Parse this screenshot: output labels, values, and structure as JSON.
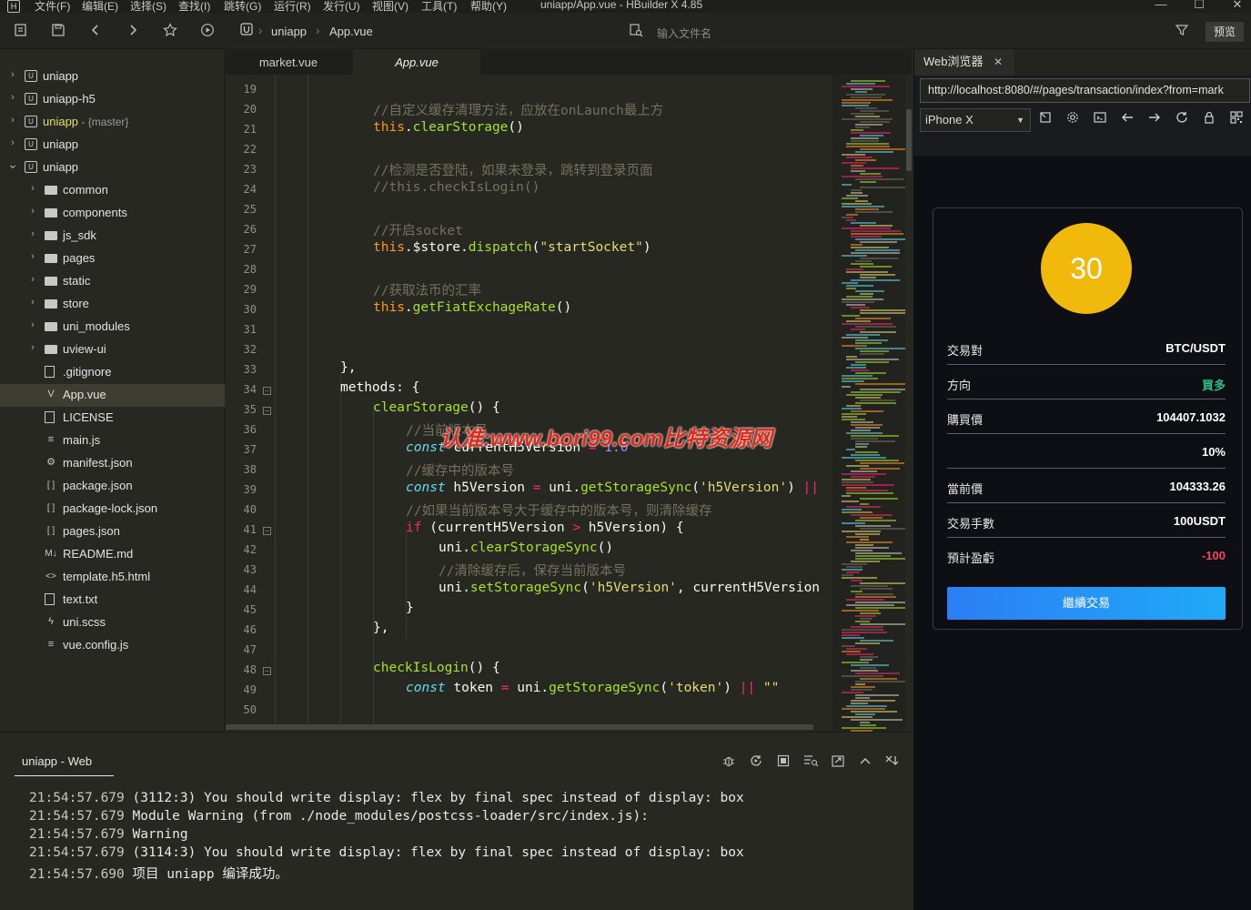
{
  "app": {
    "title": "uniapp/App.vue - HBuilder X 4.85",
    "logo": "H"
  },
  "menu": [
    "文件(F)",
    "编辑(E)",
    "选择(S)",
    "查找(I)",
    "跳转(G)",
    "运行(R)",
    "发行(U)",
    "视图(V)",
    "工具(T)",
    "帮助(Y)"
  ],
  "window_controls": [
    "—",
    "☐",
    "✕"
  ],
  "toolbar": {
    "breadcrumb": [
      "uniapp",
      "App.vue"
    ],
    "search_placeholder": "输入文件名",
    "preview_label": "预览",
    "icons": [
      "new-file-icon",
      "save-icon",
      "back-icon",
      "forward-icon",
      "star-icon",
      "run-icon",
      "filter-icon"
    ]
  },
  "sidebar": {
    "items": [
      {
        "label": "uniapp",
        "extra": "",
        "type": "project",
        "level": 0,
        "expanded": false
      },
      {
        "label": "uniapp-h5",
        "extra": "",
        "type": "project",
        "level": 0,
        "expanded": false
      },
      {
        "label": "uniapp",
        "extra": " - {master}",
        "type": "project",
        "level": 0,
        "expanded": false,
        "highlight": true
      },
      {
        "label": "uniapp",
        "extra": "",
        "type": "project",
        "level": 0,
        "expanded": false
      },
      {
        "label": "uniapp",
        "extra": "",
        "type": "project",
        "level": 0,
        "expanded": true
      },
      {
        "label": "common",
        "extra": "",
        "type": "folder",
        "level": 1
      },
      {
        "label": "components",
        "extra": "",
        "type": "folder",
        "level": 1
      },
      {
        "label": "js_sdk",
        "extra": "",
        "type": "folder",
        "level": 1
      },
      {
        "label": "pages",
        "extra": "",
        "type": "folder",
        "level": 1
      },
      {
        "label": "static",
        "extra": "",
        "type": "folder",
        "level": 1
      },
      {
        "label": "store",
        "extra": "",
        "type": "folder",
        "level": 1
      },
      {
        "label": "uni_modules",
        "extra": "",
        "type": "folder",
        "level": 1
      },
      {
        "label": "uview-ui",
        "extra": "",
        "type": "folder",
        "level": 1
      },
      {
        "label": ".gitignore",
        "extra": "",
        "type": "file",
        "glyph": "",
        "level": 1
      },
      {
        "label": "App.vue",
        "extra": "",
        "type": "file",
        "glyph": "V",
        "level": 1,
        "selected": true
      },
      {
        "label": "LICENSE",
        "extra": "",
        "type": "file",
        "glyph": "",
        "level": 1
      },
      {
        "label": "main.js",
        "extra": "",
        "type": "file",
        "glyph": "≡",
        "level": 1
      },
      {
        "label": "manifest.json",
        "extra": "",
        "type": "file",
        "glyph": "⚙",
        "level": 1
      },
      {
        "label": "package.json",
        "extra": "",
        "type": "json",
        "glyph": "[ ]",
        "level": 1
      },
      {
        "label": "package-lock.json",
        "extra": "",
        "type": "json",
        "glyph": "[ ]",
        "level": 1
      },
      {
        "label": "pages.json",
        "extra": "",
        "type": "json",
        "glyph": "[ ]",
        "level": 1
      },
      {
        "label": "README.md",
        "extra": "",
        "type": "md",
        "glyph": "M↓",
        "level": 1
      },
      {
        "label": "template.h5.html",
        "extra": "",
        "type": "html",
        "glyph": "<>",
        "level": 1
      },
      {
        "label": "text.txt",
        "extra": "",
        "type": "file",
        "glyph": "",
        "level": 1
      },
      {
        "label": "uni.scss",
        "extra": "",
        "type": "scss",
        "glyph": "ϟ",
        "level": 1
      },
      {
        "label": "vue.config.js",
        "extra": "",
        "type": "file",
        "glyph": "≡",
        "level": 1
      }
    ],
    "bottom_icons": [
      "project-manager-icon",
      "binoculars-icon",
      "bug-icon",
      "refresh-icon",
      "plugin-icon"
    ]
  },
  "tabs": [
    {
      "label": "market.vue",
      "active": false
    },
    {
      "label": "App.vue",
      "active": true
    }
  ],
  "editor": {
    "lines": [
      {
        "n": 19,
        "fold": false,
        "indent": 0,
        "tokens": []
      },
      {
        "n": 20,
        "fold": false,
        "indent": 3,
        "tokens": [
          [
            "c-comment",
            "//自定义缓存清理方法，应放在onLaunch最上方"
          ]
        ]
      },
      {
        "n": 21,
        "fold": false,
        "indent": 3,
        "tokens": [
          [
            "c-this",
            "this"
          ],
          [
            "",
            "."
          ],
          [
            "c-fn",
            "clearStorage"
          ],
          [
            "",
            "()"
          ]
        ]
      },
      {
        "n": 22,
        "fold": false,
        "indent": 0,
        "tokens": []
      },
      {
        "n": 23,
        "fold": false,
        "indent": 3,
        "tokens": [
          [
            "c-comment",
            "//检测是否登陆，如果未登录，跳转到登录页面"
          ]
        ]
      },
      {
        "n": 24,
        "fold": false,
        "indent": 3,
        "tokens": [
          [
            "c-comment",
            "//this.checkIsLogin()"
          ]
        ]
      },
      {
        "n": 25,
        "fold": false,
        "indent": 0,
        "tokens": []
      },
      {
        "n": 26,
        "fold": false,
        "indent": 3,
        "tokens": [
          [
            "c-comment",
            "//开启socket"
          ]
        ]
      },
      {
        "n": 27,
        "fold": false,
        "indent": 3,
        "tokens": [
          [
            "c-this",
            "this"
          ],
          [
            "",
            ".$store."
          ],
          [
            "c-fn",
            "dispatch"
          ],
          [
            "",
            "("
          ],
          [
            "c-str",
            "\"startSocket\""
          ],
          [
            "",
            ")"
          ]
        ]
      },
      {
        "n": 28,
        "fold": false,
        "indent": 0,
        "tokens": []
      },
      {
        "n": 29,
        "fold": false,
        "indent": 3,
        "tokens": [
          [
            "c-comment",
            "//获取法币的汇率"
          ]
        ]
      },
      {
        "n": 30,
        "fold": false,
        "indent": 3,
        "tokens": [
          [
            "c-this",
            "this"
          ],
          [
            "",
            "."
          ],
          [
            "c-fn",
            "getFiatExchageRate"
          ],
          [
            "",
            "()"
          ]
        ]
      },
      {
        "n": 31,
        "fold": false,
        "indent": 0,
        "tokens": []
      },
      {
        "n": 32,
        "fold": false,
        "indent": 0,
        "tokens": []
      },
      {
        "n": 33,
        "fold": false,
        "indent": 2,
        "tokens": [
          [
            "",
            "},"
          ]
        ]
      },
      {
        "n": 34,
        "fold": true,
        "indent": 2,
        "tokens": [
          [
            "",
            "methods: {"
          ]
        ]
      },
      {
        "n": 35,
        "fold": true,
        "indent": 3,
        "tokens": [
          [
            "c-fn",
            "clearStorage"
          ],
          [
            "",
            "() {"
          ]
        ]
      },
      {
        "n": 36,
        "fold": false,
        "indent": 4,
        "tokens": [
          [
            "c-comment",
            "//当前版本号"
          ]
        ]
      },
      {
        "n": 37,
        "fold": false,
        "indent": 4,
        "tokens": [
          [
            "c-kw",
            "const"
          ],
          [
            "",
            " currentH5Version "
          ],
          [
            "c-op",
            "="
          ],
          [
            "",
            " "
          ],
          [
            "c-num",
            "1.0"
          ]
        ]
      },
      {
        "n": 38,
        "fold": false,
        "indent": 4,
        "tokens": [
          [
            "c-comment",
            "//缓存中的版本号"
          ]
        ]
      },
      {
        "n": 39,
        "fold": false,
        "indent": 4,
        "tokens": [
          [
            "c-kw",
            "const"
          ],
          [
            "",
            " h5Version "
          ],
          [
            "c-op",
            "="
          ],
          [
            "",
            " uni."
          ],
          [
            "c-fn",
            "getStorageSync"
          ],
          [
            "",
            "("
          ],
          [
            "c-str",
            "'h5Version'"
          ],
          [
            "",
            ") "
          ],
          [
            "c-op",
            "||"
          ]
        ]
      },
      {
        "n": 40,
        "fold": false,
        "indent": 4,
        "tokens": [
          [
            "c-comment",
            "//如果当前版本号大于缓存中的版本号，则清除缓存"
          ]
        ]
      },
      {
        "n": 41,
        "fold": true,
        "indent": 4,
        "tokens": [
          [
            "c-op",
            "if"
          ],
          [
            "",
            " (currentH5Version "
          ],
          [
            "c-op",
            ">"
          ],
          [
            "",
            " h5Version) {"
          ]
        ]
      },
      {
        "n": 42,
        "fold": false,
        "indent": 5,
        "tokens": [
          [
            "",
            "uni."
          ],
          [
            "c-fn",
            "clearStorageSync"
          ],
          [
            "",
            "()"
          ]
        ]
      },
      {
        "n": 43,
        "fold": false,
        "indent": 5,
        "tokens": [
          [
            "c-comment",
            "//清除缓存后，保存当前版本号"
          ]
        ]
      },
      {
        "n": 44,
        "fold": false,
        "indent": 5,
        "tokens": [
          [
            "",
            "uni."
          ],
          [
            "c-fn",
            "setStorageSync"
          ],
          [
            "",
            "("
          ],
          [
            "c-str",
            "'h5Version'"
          ],
          [
            "",
            ", currentH5Version"
          ]
        ]
      },
      {
        "n": 45,
        "fold": false,
        "indent": 4,
        "tokens": [
          [
            "",
            "}"
          ]
        ]
      },
      {
        "n": 46,
        "fold": false,
        "indent": 3,
        "tokens": [
          [
            "",
            "},"
          ]
        ]
      },
      {
        "n": 47,
        "fold": false,
        "indent": 0,
        "tokens": []
      },
      {
        "n": 48,
        "fold": true,
        "indent": 3,
        "tokens": [
          [
            "c-fn",
            "checkIsLogin"
          ],
          [
            "",
            "() {"
          ]
        ]
      },
      {
        "n": 49,
        "fold": false,
        "indent": 4,
        "tokens": [
          [
            "c-kw",
            "const"
          ],
          [
            "",
            " token "
          ],
          [
            "c-op",
            "="
          ],
          [
            "",
            " uni."
          ],
          [
            "c-fn",
            "getStorageSync"
          ],
          [
            "",
            "("
          ],
          [
            "c-str",
            "'token'"
          ],
          [
            "",
            ") "
          ],
          [
            "c-op",
            "||"
          ],
          [
            "",
            " "
          ],
          [
            "c-str",
            "\"\""
          ]
        ]
      },
      {
        "n": 50,
        "fold": false,
        "indent": 0,
        "tokens": []
      }
    ],
    "watermark": "认准:www.bori99.com比特资源网"
  },
  "console": {
    "tab_label": "uniapp - Web",
    "icons": [
      "debug-icon",
      "reload-icon",
      "stop-icon",
      "clear-icon",
      "export-icon",
      "collapse-up-icon",
      "close-console-icon"
    ],
    "lines": [
      {
        "ts": "21:54:57.679",
        "msg": " (3112:3) You should write display: flex by final spec instead of display: box"
      },
      {
        "ts": "21:54:57.679",
        "msg": " Module Warning (from ./node_modules/postcss-loader/src/index.js):"
      },
      {
        "ts": "21:54:57.679",
        "msg": " Warning"
      },
      {
        "ts": "21:54:57.679",
        "msg": " (3114:3) You should write display: flex by final spec instead of display: box"
      },
      {
        "ts": "21:54:57.690",
        "msg": " 项目 uniapp 编译成功。"
      }
    ]
  },
  "browser": {
    "tab_label": "Web浏览器",
    "close_label": "✕",
    "url": "http://localhost:8080/#/pages/transaction/index?from=mark",
    "device": "iPhone X",
    "icons": [
      "rotate-icon",
      "settings-icon",
      "devtools-icon",
      "back-icon",
      "forward-icon",
      "reload-icon",
      "lock-icon",
      "qrcode-icon"
    ],
    "card": {
      "countdown": "30",
      "rows": [
        {
          "key": "交易對",
          "value": "BTC/USDT",
          "color": ""
        },
        {
          "key": "方向",
          "value": "買多",
          "color": "green"
        },
        {
          "key": "購買價",
          "value": "104407.1032",
          "color": ""
        },
        {
          "key": "",
          "value": "10%",
          "color": ""
        },
        {
          "key": "當前價",
          "value": "104333.26",
          "color": ""
        },
        {
          "key": "交易手數",
          "value": "100USDT",
          "color": ""
        },
        {
          "key": "預計盈虧",
          "value": "-100",
          "color": "red"
        }
      ],
      "button_label": "繼續交易"
    }
  },
  "colors": {
    "editor_bg": "#272822",
    "accent_button": "#2b7ef5",
    "timer": "#f0b90b",
    "profit_green": "#2ebd85",
    "loss_red": "#f6465d",
    "watermark": "#e02a1a"
  }
}
